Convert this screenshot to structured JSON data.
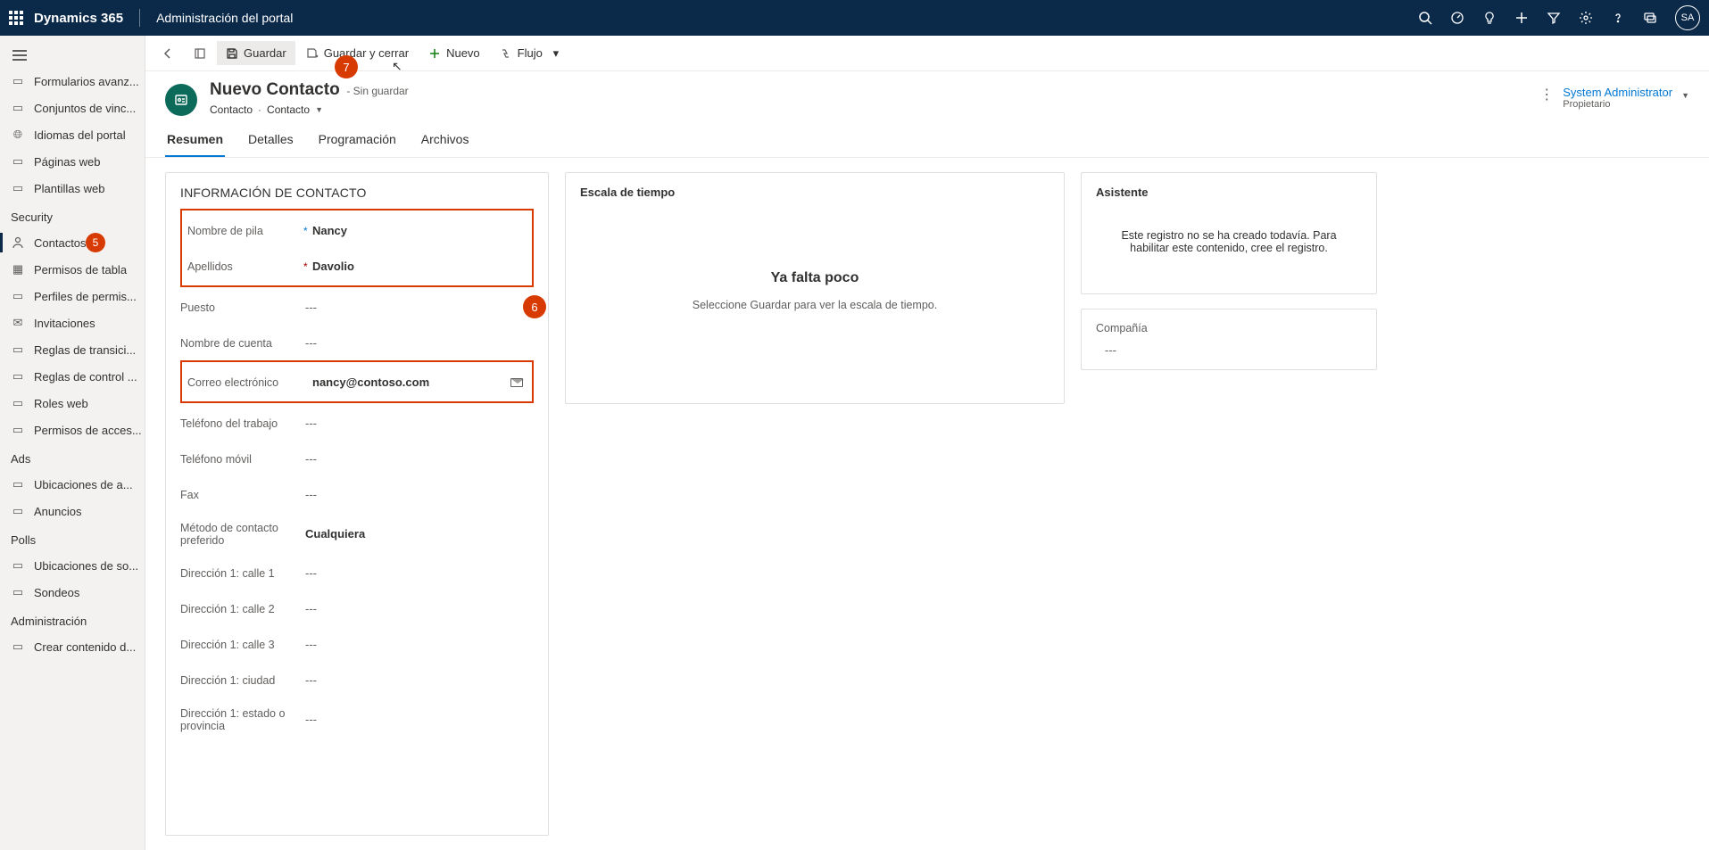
{
  "topbar": {
    "brand": "Dynamics 365",
    "app_title": "Administración del portal",
    "avatar_initials": "SA"
  },
  "sidebar": {
    "groups": [
      {
        "title": "",
        "items": [
          {
            "label": "Formularios avanz...",
            "icon": "form"
          },
          {
            "label": "Conjuntos de vinc...",
            "icon": "link"
          },
          {
            "label": "Idiomas del portal",
            "icon": "globe"
          },
          {
            "label": "Páginas web",
            "icon": "page"
          },
          {
            "label": "Plantillas web",
            "icon": "template"
          }
        ]
      },
      {
        "title": "Security",
        "items": [
          {
            "label": "Contactos",
            "icon": "person",
            "active": true,
            "badge": "5"
          },
          {
            "label": "Permisos de tabla",
            "icon": "table"
          },
          {
            "label": "Perfiles de permis...",
            "icon": "profile"
          },
          {
            "label": "Invitaciones",
            "icon": "mail"
          },
          {
            "label": "Reglas de transici...",
            "icon": "rule"
          },
          {
            "label": "Reglas de control ...",
            "icon": "rule"
          },
          {
            "label": "Roles web",
            "icon": "role"
          },
          {
            "label": "Permisos de acces...",
            "icon": "access"
          }
        ]
      },
      {
        "title": "Ads",
        "items": [
          {
            "label": "Ubicaciones de a...",
            "icon": "location"
          },
          {
            "label": "Anuncios",
            "icon": "announce"
          }
        ]
      },
      {
        "title": "Polls",
        "items": [
          {
            "label": "Ubicaciones de so...",
            "icon": "location"
          },
          {
            "label": "Sondeos",
            "icon": "poll"
          }
        ]
      },
      {
        "title": "Administración",
        "items": [
          {
            "label": "Crear contenido d...",
            "icon": "create"
          }
        ]
      }
    ]
  },
  "cmdbar": {
    "save": "Guardar",
    "save_close": "Guardar y cerrar",
    "new": "Nuevo",
    "flow": "Flujo"
  },
  "annotations": {
    "badge7": "7",
    "badge6": "6",
    "badge5": "5"
  },
  "header": {
    "title": "Nuevo Contacto",
    "unsaved": "- Sin guardar",
    "breadcrumb1": "Contacto",
    "breadcrumb2": "Contacto",
    "owner": "System Administrator",
    "owner_label": "Propietario"
  },
  "tabs": [
    "Resumen",
    "Detalles",
    "Programación",
    "Archivos"
  ],
  "contact_section": {
    "title": "INFORMACIÓN DE CONTACTO",
    "empty": "---",
    "fields": {
      "first_name_label": "Nombre de pila",
      "first_name_value": "Nancy",
      "last_name_label": "Apellidos",
      "last_name_value": "Davolio",
      "job_label": "Puesto",
      "account_label": "Nombre de cuenta",
      "email_label": "Correo electrónico",
      "email_value": "nancy@contoso.com",
      "workphone_label": "Teléfono del trabajo",
      "mobile_label": "Teléfono móvil",
      "fax_label": "Fax",
      "method_label": "Método de contacto preferido",
      "method_value": "Cualquiera",
      "st1_label": "Dirección 1: calle 1",
      "st2_label": "Dirección 1: calle 2",
      "st3_label": "Dirección 1: calle 3",
      "city_label": "Dirección 1: ciudad",
      "state_label": "Dirección 1: estado o provincia"
    }
  },
  "timeline": {
    "title": "Escala de tiempo",
    "big": "Ya falta poco",
    "small": "Seleccione Guardar para ver la escala de tiempo."
  },
  "assistant": {
    "title": "Asistente",
    "msg": "Este registro no se ha creado todavía. Para habilitar este contenido, cree el registro."
  },
  "company": {
    "label": "Compañía",
    "value": "---"
  }
}
